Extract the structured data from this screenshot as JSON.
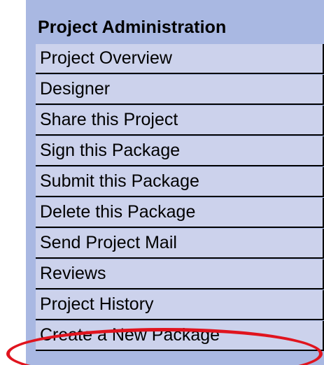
{
  "panel": {
    "title": "Project Administration",
    "background_color": "#a9b8e2",
    "item_color": "#ccd2ec"
  },
  "menu": {
    "items": [
      {
        "label": "Project Overview"
      },
      {
        "label": "Designer"
      },
      {
        "label": "Share this Project"
      },
      {
        "label": "Sign this Package"
      },
      {
        "label": "Submit this Package"
      },
      {
        "label": "Delete this Package"
      },
      {
        "label": "Send Project Mail"
      },
      {
        "label": "Reviews"
      },
      {
        "label": "Project History"
      },
      {
        "label": "Create a New Package"
      }
    ]
  },
  "annotation": {
    "type": "ellipse-highlight",
    "target": "Create a New Package",
    "color": "#e0141e"
  }
}
